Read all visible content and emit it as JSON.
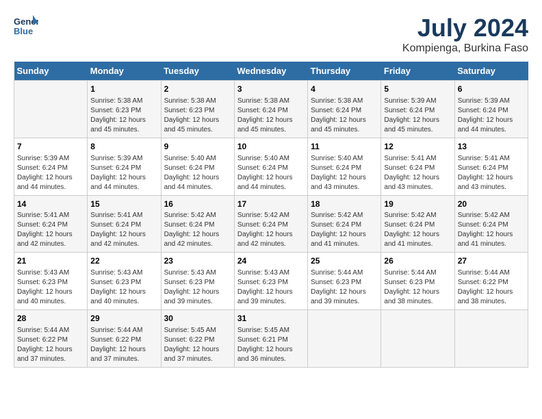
{
  "header": {
    "logo_line1": "General",
    "logo_line2": "Blue",
    "title": "July 2024",
    "subtitle": "Kompienga, Burkina Faso"
  },
  "calendar": {
    "days_of_week": [
      "Sunday",
      "Monday",
      "Tuesday",
      "Wednesday",
      "Thursday",
      "Friday",
      "Saturday"
    ],
    "weeks": [
      [
        {
          "day": "",
          "info": ""
        },
        {
          "day": "1",
          "info": "Sunrise: 5:38 AM\nSunset: 6:23 PM\nDaylight: 12 hours\nand 45 minutes."
        },
        {
          "day": "2",
          "info": "Sunrise: 5:38 AM\nSunset: 6:23 PM\nDaylight: 12 hours\nand 45 minutes."
        },
        {
          "day": "3",
          "info": "Sunrise: 5:38 AM\nSunset: 6:24 PM\nDaylight: 12 hours\nand 45 minutes."
        },
        {
          "day": "4",
          "info": "Sunrise: 5:38 AM\nSunset: 6:24 PM\nDaylight: 12 hours\nand 45 minutes."
        },
        {
          "day": "5",
          "info": "Sunrise: 5:39 AM\nSunset: 6:24 PM\nDaylight: 12 hours\nand 45 minutes."
        },
        {
          "day": "6",
          "info": "Sunrise: 5:39 AM\nSunset: 6:24 PM\nDaylight: 12 hours\nand 44 minutes."
        }
      ],
      [
        {
          "day": "7",
          "info": "Sunrise: 5:39 AM\nSunset: 6:24 PM\nDaylight: 12 hours\nand 44 minutes."
        },
        {
          "day": "8",
          "info": "Sunrise: 5:39 AM\nSunset: 6:24 PM\nDaylight: 12 hours\nand 44 minutes."
        },
        {
          "day": "9",
          "info": "Sunrise: 5:40 AM\nSunset: 6:24 PM\nDaylight: 12 hours\nand 44 minutes."
        },
        {
          "day": "10",
          "info": "Sunrise: 5:40 AM\nSunset: 6:24 PM\nDaylight: 12 hours\nand 44 minutes."
        },
        {
          "day": "11",
          "info": "Sunrise: 5:40 AM\nSunset: 6:24 PM\nDaylight: 12 hours\nand 43 minutes."
        },
        {
          "day": "12",
          "info": "Sunrise: 5:41 AM\nSunset: 6:24 PM\nDaylight: 12 hours\nand 43 minutes."
        },
        {
          "day": "13",
          "info": "Sunrise: 5:41 AM\nSunset: 6:24 PM\nDaylight: 12 hours\nand 43 minutes."
        }
      ],
      [
        {
          "day": "14",
          "info": "Sunrise: 5:41 AM\nSunset: 6:24 PM\nDaylight: 12 hours\nand 42 minutes."
        },
        {
          "day": "15",
          "info": "Sunrise: 5:41 AM\nSunset: 6:24 PM\nDaylight: 12 hours\nand 42 minutes."
        },
        {
          "day": "16",
          "info": "Sunrise: 5:42 AM\nSunset: 6:24 PM\nDaylight: 12 hours\nand 42 minutes."
        },
        {
          "day": "17",
          "info": "Sunrise: 5:42 AM\nSunset: 6:24 PM\nDaylight: 12 hours\nand 42 minutes."
        },
        {
          "day": "18",
          "info": "Sunrise: 5:42 AM\nSunset: 6:24 PM\nDaylight: 12 hours\nand 41 minutes."
        },
        {
          "day": "19",
          "info": "Sunrise: 5:42 AM\nSunset: 6:24 PM\nDaylight: 12 hours\nand 41 minutes."
        },
        {
          "day": "20",
          "info": "Sunrise: 5:42 AM\nSunset: 6:24 PM\nDaylight: 12 hours\nand 41 minutes."
        }
      ],
      [
        {
          "day": "21",
          "info": "Sunrise: 5:43 AM\nSunset: 6:23 PM\nDaylight: 12 hours\nand 40 minutes."
        },
        {
          "day": "22",
          "info": "Sunrise: 5:43 AM\nSunset: 6:23 PM\nDaylight: 12 hours\nand 40 minutes."
        },
        {
          "day": "23",
          "info": "Sunrise: 5:43 AM\nSunset: 6:23 PM\nDaylight: 12 hours\nand 39 minutes."
        },
        {
          "day": "24",
          "info": "Sunrise: 5:43 AM\nSunset: 6:23 PM\nDaylight: 12 hours\nand 39 minutes."
        },
        {
          "day": "25",
          "info": "Sunrise: 5:44 AM\nSunset: 6:23 PM\nDaylight: 12 hours\nand 39 minutes."
        },
        {
          "day": "26",
          "info": "Sunrise: 5:44 AM\nSunset: 6:23 PM\nDaylight: 12 hours\nand 38 minutes."
        },
        {
          "day": "27",
          "info": "Sunrise: 5:44 AM\nSunset: 6:22 PM\nDaylight: 12 hours\nand 38 minutes."
        }
      ],
      [
        {
          "day": "28",
          "info": "Sunrise: 5:44 AM\nSunset: 6:22 PM\nDaylight: 12 hours\nand 37 minutes."
        },
        {
          "day": "29",
          "info": "Sunrise: 5:44 AM\nSunset: 6:22 PM\nDaylight: 12 hours\nand 37 minutes."
        },
        {
          "day": "30",
          "info": "Sunrise: 5:45 AM\nSunset: 6:22 PM\nDaylight: 12 hours\nand 37 minutes."
        },
        {
          "day": "31",
          "info": "Sunrise: 5:45 AM\nSunset: 6:21 PM\nDaylight: 12 hours\nand 36 minutes."
        },
        {
          "day": "",
          "info": ""
        },
        {
          "day": "",
          "info": ""
        },
        {
          "day": "",
          "info": ""
        }
      ]
    ]
  }
}
